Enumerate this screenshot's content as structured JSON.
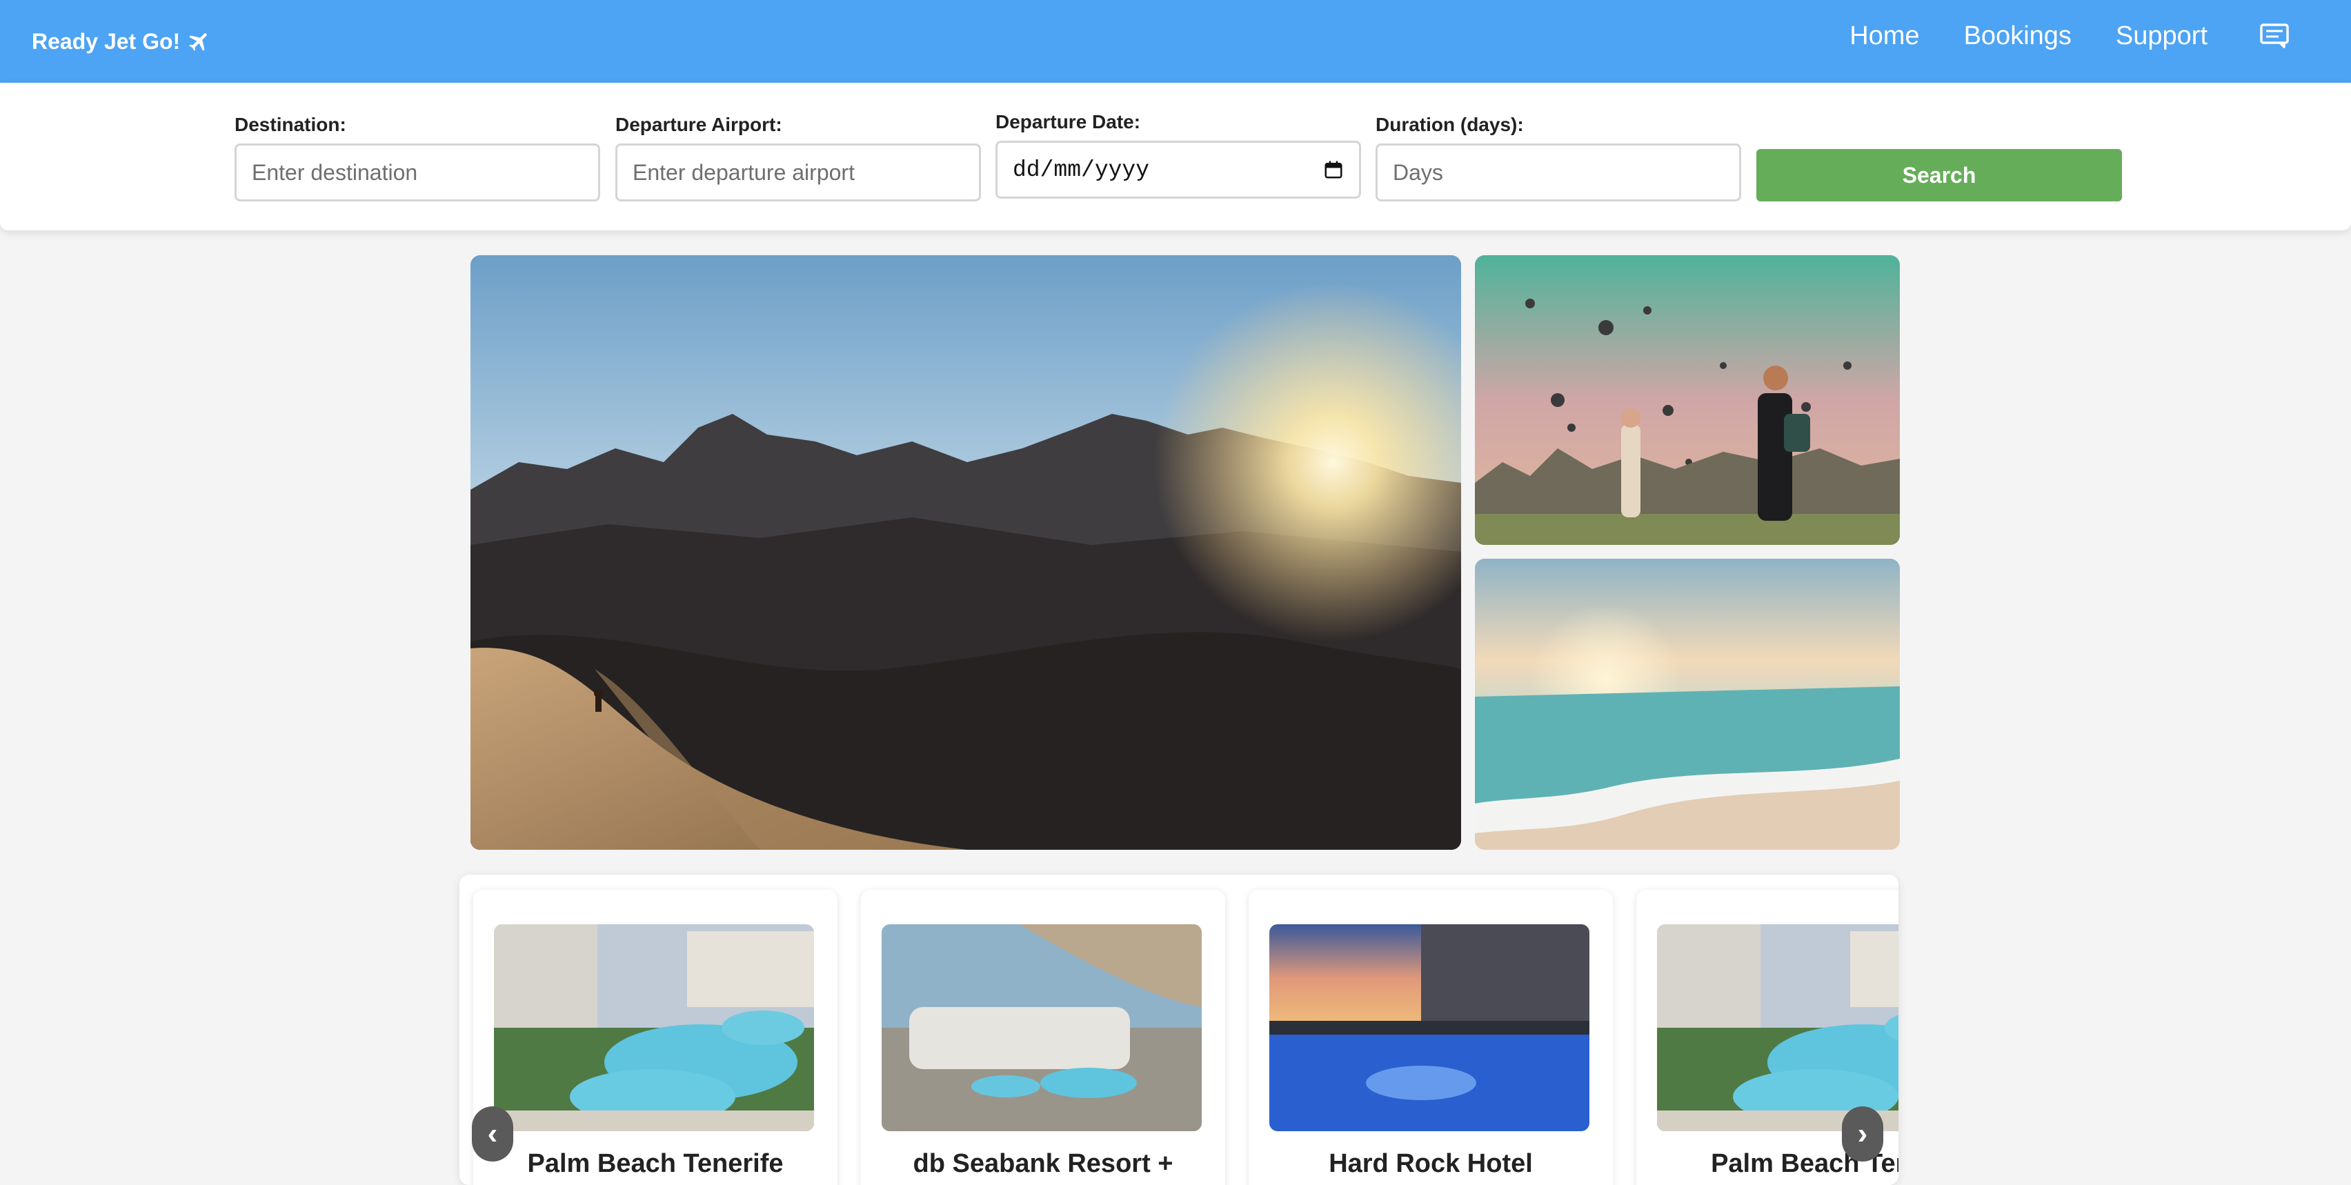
{
  "navbar": {
    "brand": "Ready Jet Go!",
    "brand_icon": "airplane-icon",
    "links": [
      {
        "label": "Home"
      },
      {
        "label": "Bookings"
      },
      {
        "label": "Support"
      }
    ],
    "chat_icon": "chat-icon"
  },
  "search": {
    "destination": {
      "label": "Destination:",
      "placeholder": "Enter destination"
    },
    "departure_airport": {
      "label": "Departure Airport:",
      "placeholder": "Enter departure airport"
    },
    "departure_date": {
      "label": "Departure Date:",
      "value": "dd/mm/yyyy",
      "icon": "calendar-icon"
    },
    "duration": {
      "label": "Duration (days):",
      "placeholder": "Days"
    },
    "button_label": "Search",
    "button_color": "#66ad5a"
  },
  "gallery": {
    "main_image": "desert-dunes-sunset-photo",
    "side_images": [
      "hot-air-balloons-photo",
      "beach-sunset-photo"
    ]
  },
  "carousel": {
    "cards": [
      {
        "title": "Palm Beach Tenerife",
        "image": "resort-pool-photo"
      },
      {
        "title": "db Seabank Resort +",
        "image": "coastal-resort-photo"
      },
      {
        "title": "Hard Rock Hotel",
        "image": "hotel-pool-sunset-photo"
      },
      {
        "title": "Palm Beach Tene",
        "image": "resort-pool-photo"
      }
    ],
    "prev_icon": "chevron-left-icon",
    "next_icon": "chevron-right-icon",
    "prev_glyph": "‹",
    "next_glyph": "›"
  },
  "colors": {
    "navbar": "#4da3f4",
    "search_button": "#66ad5a"
  }
}
